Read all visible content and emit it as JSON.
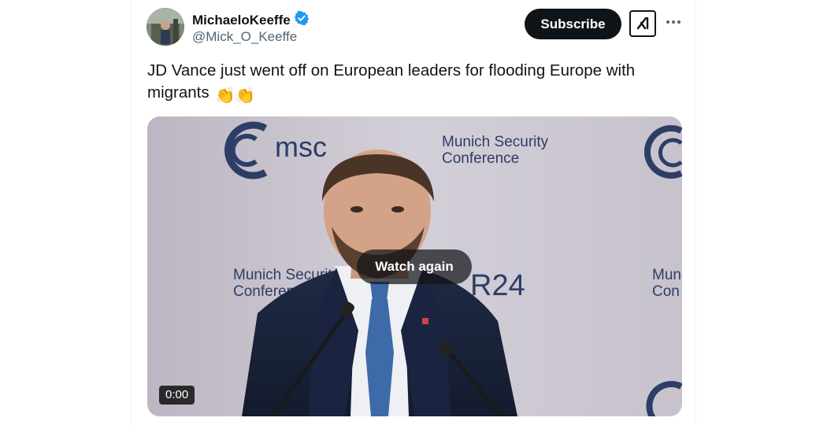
{
  "author": {
    "name": "MichaeloKeeffe",
    "handle": "@Mick_O_Keeffe",
    "verified": true,
    "verified_color": "#1d9bf0"
  },
  "actions": {
    "subscribe_label": "Subscribe",
    "grok_icon": "grok-icon",
    "more_icon": "more-icon"
  },
  "tweet": {
    "text": "JD Vance just went off on European leaders for flooding Europe with migrants",
    "emoji": "👏👏"
  },
  "video": {
    "overlay_label": "Watch again",
    "timestamp": "0:00",
    "backdrop": {
      "logo_text": "msc",
      "conference_line1": "Munich Security",
      "conference_line2": "Conference",
      "left_line1": "Munich Securit",
      "left_line2": "Conference",
      "right_line1": "Mun",
      "right_line2": "Con",
      "year_text": "R24"
    }
  },
  "colors": {
    "accent": "#0f1419",
    "secondary_text": "#536471",
    "brand_blue": "#2d3e66"
  }
}
